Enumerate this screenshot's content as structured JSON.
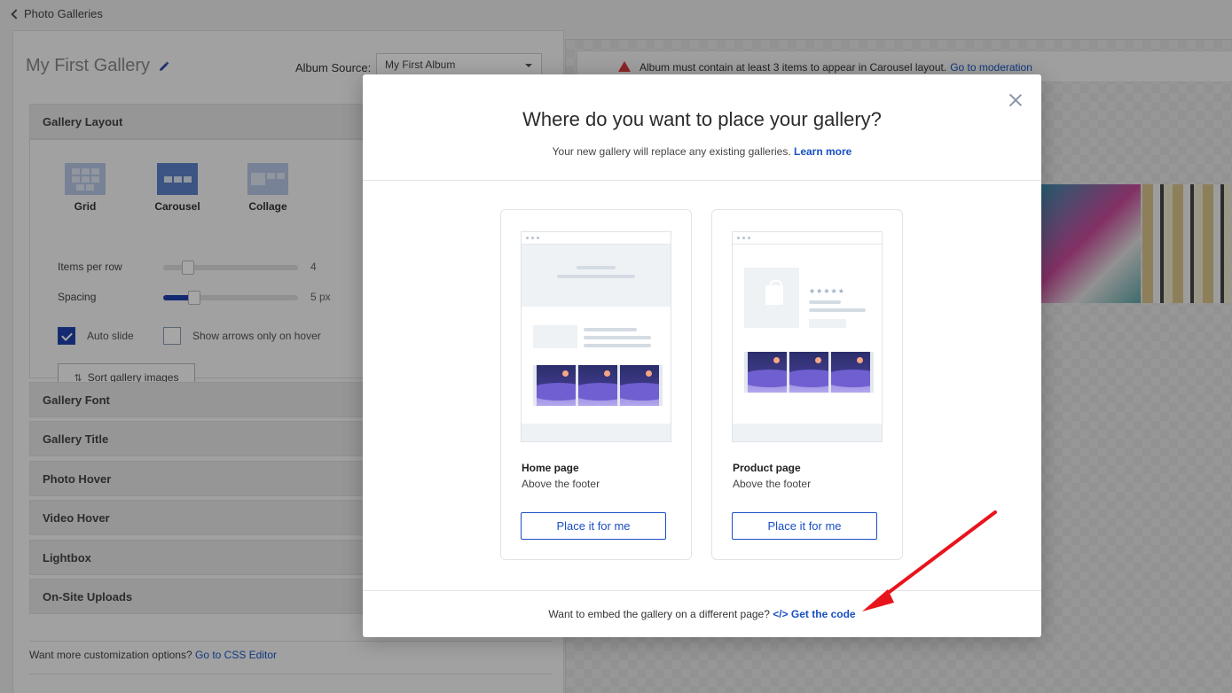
{
  "breadcrumb": {
    "back_label": "Photo Galleries"
  },
  "gallery": {
    "name": "My First Gallery",
    "album_source_label": "Album Source:",
    "album_source_value": "My First Album"
  },
  "layout_section": {
    "title": "Gallery Layout",
    "options": [
      {
        "label": "Grid"
      },
      {
        "label": "Carousel"
      },
      {
        "label": "Collage"
      }
    ],
    "selected": "Carousel",
    "items_per_row_label": "Items per row",
    "items_per_row_value": "4",
    "items_per_row_fraction": 0.15,
    "spacing_label": "Spacing",
    "spacing_value": "5 px",
    "spacing_fraction": 0.2,
    "auto_slide_label": "Auto slide",
    "auto_slide_checked": true,
    "arrows_hover_label": "Show arrows only on hover",
    "arrows_hover_checked": false,
    "sort_button_label": "Sort gallery images"
  },
  "sections": [
    {
      "title": "Gallery Font"
    },
    {
      "title": "Gallery Title"
    },
    {
      "title": "Photo Hover"
    },
    {
      "title": "Video Hover"
    },
    {
      "title": "Lightbox"
    },
    {
      "title": "On-Site Uploads"
    }
  ],
  "footer_note": {
    "text": "Want more customization options?",
    "link": "Go to CSS Editor"
  },
  "alert": {
    "text": "Album must contain at least 3 items to appear in Carousel layout.",
    "link": "Go to moderation",
    "color": "#d9363e"
  },
  "modal": {
    "title": "Where do you want to place your gallery?",
    "subtitle": "Your new gallery will replace any existing galleries.",
    "subtitle_link": "Learn more",
    "cards": [
      {
        "title": "Home page",
        "subtitle": "Above the footer",
        "button": "Place it for me"
      },
      {
        "title": "Product page",
        "subtitle": "Above the footer",
        "button": "Place it for me"
      }
    ],
    "embed_text": "Want to embed the gallery on a different page?",
    "embed_link": "</> Get the code",
    "mock_stars": "★★★★★"
  },
  "colors": {
    "accent": "#1a4fc4",
    "annotation_arrow": "#e8141c"
  }
}
